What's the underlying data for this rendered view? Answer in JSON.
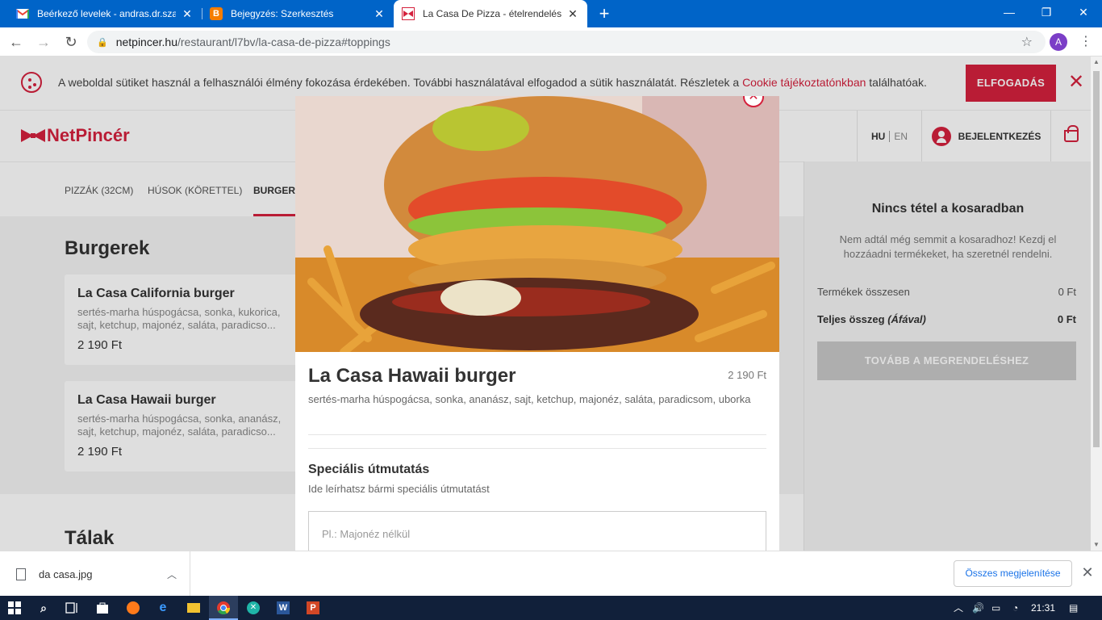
{
  "browser": {
    "tabs": [
      {
        "title": "Beérkező levelek - andras.dr.szabo",
        "icon": "gmail-icon",
        "active": false
      },
      {
        "title": "Bejegyzés: Szerkesztés",
        "icon": "blogger-icon",
        "active": false
      },
      {
        "title": "La Casa De Pizza - ételrendelés, h",
        "icon": "netpincer-icon",
        "active": true
      }
    ],
    "url_host": "netpincer.hu",
    "url_path": "/restaurant/l7bv/la-casa-de-pizza#toppings",
    "profile_initial": "A"
  },
  "cookie_banner": {
    "text_before": "A weboldal sütiket használ a felhasználói élmény fokozása érdekében. További használatával elfogadod a sütik használatát. Részletek a ",
    "link": "Cookie tájékoztatónkban",
    "text_after": " találhatóak.",
    "accept_label": "ELFOGADÁS"
  },
  "header": {
    "logo_text": "NetPincér",
    "lang_hu": "HU",
    "lang_en": "EN",
    "login_label": "BEJELENTKEZÉS"
  },
  "categories": [
    {
      "label": "PIZZÁK (32CM)"
    },
    {
      "label": "HÚSOK (KÖRETTEL)"
    },
    {
      "label": "BURGEREK"
    }
  ],
  "menu": {
    "section1_title": "Burgerek",
    "products": [
      {
        "name": "La Casa California burger",
        "desc": "sertés-marha húspogácsa, sonka, kukorica, sajt, ketchup, majonéz, saláta, paradicso...",
        "price": "2 190 Ft"
      },
      {
        "name": "La Casa Hawaii burger",
        "desc": "sertés-marha húspogácsa, sonka, ananász, sajt, ketchup, majonéz, saláta, paradicso...",
        "price": "2 190 Ft"
      }
    ],
    "section2_title": "Tálak"
  },
  "cart": {
    "title": "Nincs tétel a kosaradban",
    "empty_text": "Nem adtál még semmit a kosaradhoz! Kezdj el hozzáadni termékeket, ha szeretnél rendelni.",
    "subtotal_label": "Termékek összesen",
    "subtotal_value": "0 Ft",
    "total_label": "Teljes összeg ",
    "total_vat": "(Áfával)",
    "total_value": "0 Ft",
    "checkout_label": "TOVÁBB A MEGRENDELÉSHEZ"
  },
  "modal": {
    "name": "La Casa Hawaii burger",
    "price": "2 190 Ft",
    "desc": "sertés-marha húspogácsa, sonka, ananász, sajt, ketchup, majonéz, saláta, paradicsom, uborka",
    "special_title": "Speciális útmutatás",
    "special_desc": "Ide leírhatsz bármi speciális útmutatást",
    "note_placeholder": "Pl.: Majonéz nélkül"
  },
  "downloads": {
    "file_name": "da casa.jpg",
    "show_all": "Összes megjelenítése"
  },
  "taskbar": {
    "time": "21:31"
  },
  "colors": {
    "brand_red": "#d5213d",
    "chrome_blue": "#0064c8"
  }
}
